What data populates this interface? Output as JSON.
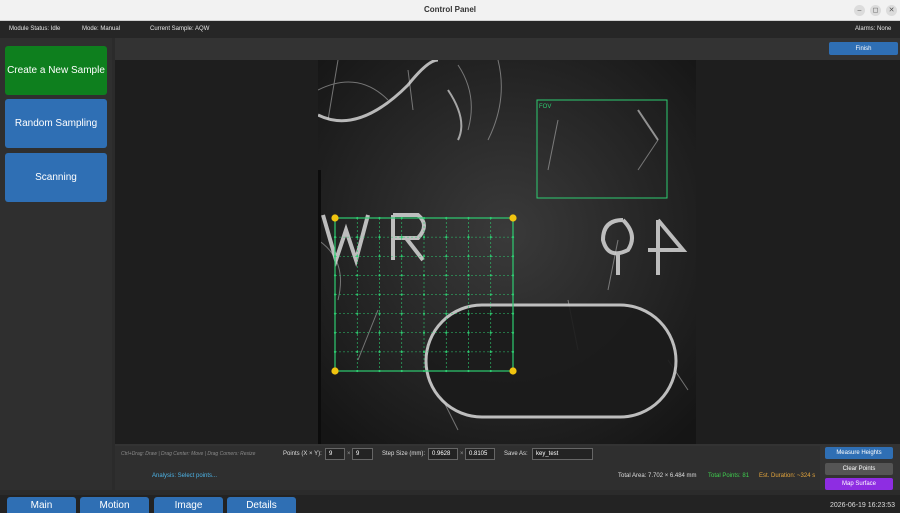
{
  "window": {
    "title": "Control Panel"
  },
  "status": {
    "module": "Module Status: Idle",
    "mode": "Mode: Manual",
    "sample": "Current Sample: AQW",
    "alarms": "Alarms: None"
  },
  "sidebar": {
    "items": [
      {
        "label": "Create a New Sample",
        "color": "#0e7f1e"
      },
      {
        "label": "Random Sampling",
        "color": "#2f6fb4"
      },
      {
        "label": "Scanning",
        "color": "#2f6fb4"
      }
    ]
  },
  "toolbar": {
    "finish_label": "Finish"
  },
  "view": {
    "fov_label": "FOV"
  },
  "controls": {
    "hint": "Ctrl+Drag: Draw  |  Drag Center: Move  |  Drag Corners: Resize",
    "points_label": "Points (X × Y):",
    "points_x": "9",
    "points_y": "9",
    "times": "×",
    "step_label": "Step Size (mm):",
    "step_x": "0.9628",
    "step_y": "0.8105",
    "save_label": "Save As:",
    "save_value": "key_test",
    "analysis": "Analysis: Select points...",
    "total_area": "Total Area: 7.702 × 6.484 mm",
    "total_points": "Total Points: 81",
    "duration": "Est. Duration: ~324 s"
  },
  "actions": {
    "measure": "Measure Heights",
    "clear": "Clear Points",
    "map": "Map Surface"
  },
  "tabs": [
    "Main",
    "Motion",
    "Image",
    "Details"
  ],
  "clock": "2026-06-19 16:23:53",
  "colors": {
    "accent": "#2f6fb4",
    "grid": "#2ecc71",
    "handle": "#f1c40f",
    "map": "#8e2de2"
  }
}
